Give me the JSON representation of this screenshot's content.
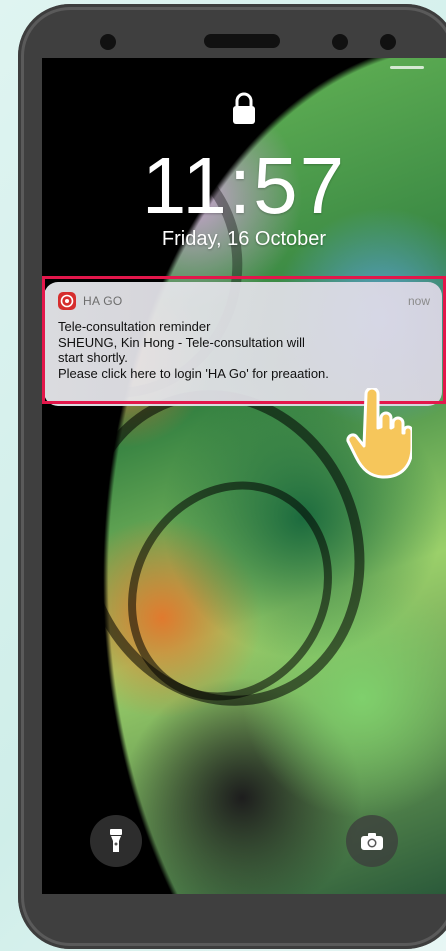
{
  "lockscreen": {
    "time": "11:57",
    "date": "Friday, 16 October"
  },
  "notification": {
    "app_name": "HA GO",
    "time_ago": "now",
    "lines": [
      "Tele-consultation reminder",
      "SHEUNG, Kin Hong - Tele-consultation will",
      "start shortly.",
      "Please click here to login 'HA Go' for preaation."
    ]
  },
  "colors": {
    "highlight": "#e3174b",
    "app_icon": "#d62d2d"
  },
  "icons": {
    "lock": "lock-icon",
    "flashlight": "flashlight-icon",
    "camera": "camera-icon",
    "hand": "pointing-hand-icon"
  }
}
